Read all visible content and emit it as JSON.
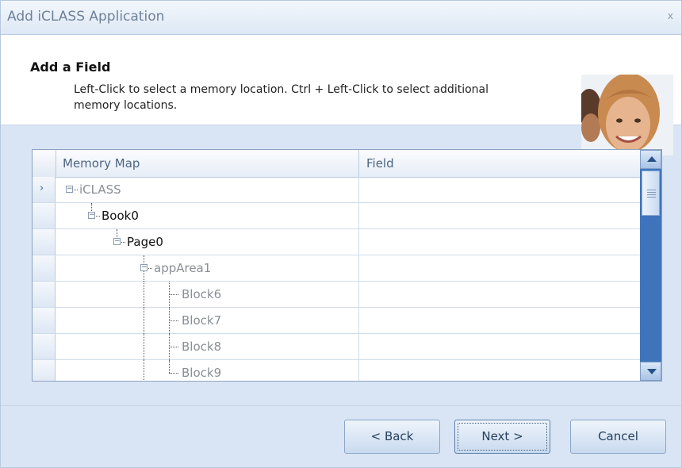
{
  "window": {
    "title": "Add iCLASS Application",
    "close_glyph": "x"
  },
  "header": {
    "title": "Add a Field",
    "description": "Left-Click to select a memory location.  Ctrl + Left-Click to select additional memory locations.",
    "image": "people-photo"
  },
  "grid": {
    "columns": [
      "Memory Map",
      "Field"
    ],
    "rows": [
      {
        "label": "iCLASS",
        "selected": true,
        "expander": "minus"
      },
      {
        "label": "Book0",
        "selected": false,
        "expander": "minus"
      },
      {
        "label": "Page0",
        "selected": false,
        "expander": "minus"
      },
      {
        "label": "appArea1",
        "selected": false,
        "expander": "minus"
      },
      {
        "label": "Block6",
        "selected": false,
        "expander": ""
      },
      {
        "label": "Block7",
        "selected": false,
        "expander": ""
      },
      {
        "label": "Block8",
        "selected": false,
        "expander": ""
      },
      {
        "label": "Block9",
        "selected": false,
        "expander": ""
      }
    ],
    "current_row_indicator": "›"
  },
  "buttons": {
    "back": "< Back",
    "next": "Next >",
    "cancel": "Cancel"
  },
  "icons": {
    "close": "close-icon",
    "current_row": "chevron-right-icon",
    "scroll_up": "triangle-up-icon",
    "scroll_down": "triangle-down-icon"
  }
}
